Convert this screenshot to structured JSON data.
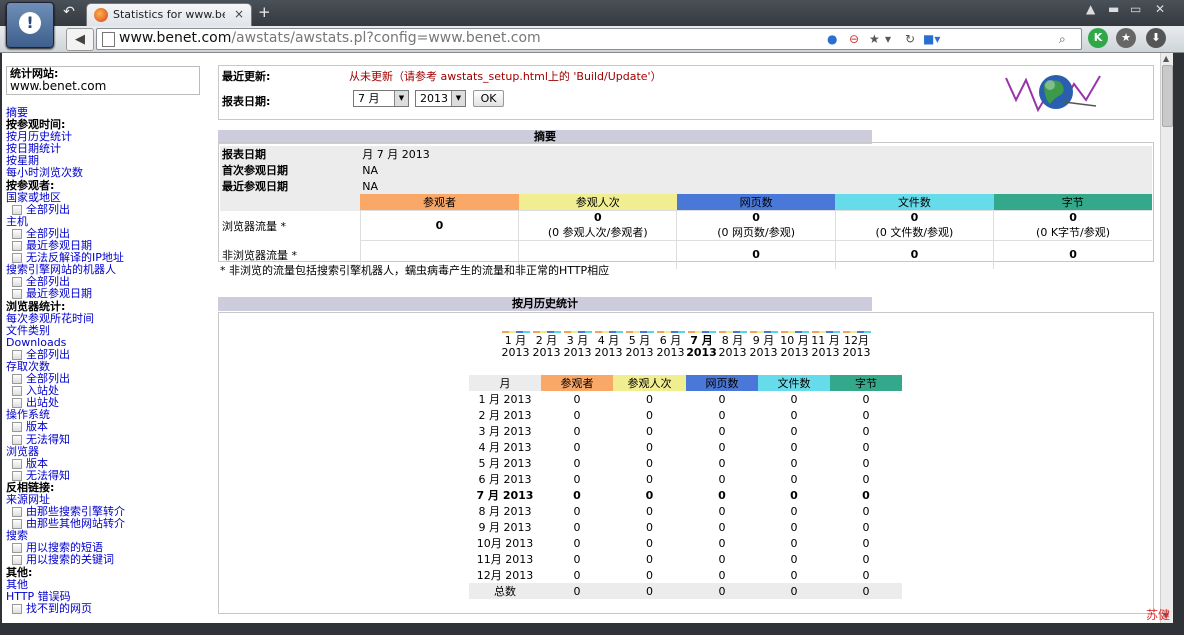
{
  "browser": {
    "tab_title": "Statistics for www.ben…",
    "tab_close": "×",
    "new_tab": "+",
    "url_domain": "www.benet.com",
    "url_path": "/awstats/awstats.pl?config=www.benet.com"
  },
  "sidebar": {
    "site_label": "统计网站:",
    "site_value": "www.benet.com",
    "items": [
      {
        "text": "摘要",
        "kind": "link"
      },
      {
        "text": "按参观时间:",
        "kind": "head"
      },
      {
        "text": "按月历史统计",
        "kind": "link"
      },
      {
        "text": "按日期统计",
        "kind": "link"
      },
      {
        "text": "按星期",
        "kind": "link"
      },
      {
        "text": "每小时浏览次数",
        "kind": "link"
      },
      {
        "text": "按参观者:",
        "kind": "head"
      },
      {
        "text": "国家或地区",
        "kind": "link"
      },
      {
        "text": "全部列出",
        "kind": "sub"
      },
      {
        "text": "主机",
        "kind": "link"
      },
      {
        "text": "全部列出",
        "kind": "sub"
      },
      {
        "text": "最近参观日期",
        "kind": "sub"
      },
      {
        "text": "无法反解译的IP地址",
        "kind": "sub"
      },
      {
        "text": "搜索引擎网站的机器人",
        "kind": "link"
      },
      {
        "text": "全部列出",
        "kind": "sub"
      },
      {
        "text": "最近参观日期",
        "kind": "sub"
      },
      {
        "text": "浏览器统计:",
        "kind": "head"
      },
      {
        "text": "每次参观所花时间",
        "kind": "link"
      },
      {
        "text": "文件类别",
        "kind": "link"
      },
      {
        "text": "Downloads",
        "kind": "link"
      },
      {
        "text": "全部列出",
        "kind": "sub"
      },
      {
        "text": "存取次数",
        "kind": "link"
      },
      {
        "text": "全部列出",
        "kind": "sub"
      },
      {
        "text": "入站处",
        "kind": "sub"
      },
      {
        "text": "出站处",
        "kind": "sub"
      },
      {
        "text": "操作系统",
        "kind": "link"
      },
      {
        "text": "版本",
        "kind": "sub"
      },
      {
        "text": "无法得知",
        "kind": "sub"
      },
      {
        "text": "浏览器",
        "kind": "link"
      },
      {
        "text": "版本",
        "kind": "sub"
      },
      {
        "text": "无法得知",
        "kind": "sub"
      },
      {
        "text": "反相链接:",
        "kind": "head"
      },
      {
        "text": "来源网址",
        "kind": "link"
      },
      {
        "text": "由那些搜索引擎转介",
        "kind": "sub"
      },
      {
        "text": "由那些其他网站转介",
        "kind": "sub"
      },
      {
        "text": "搜索",
        "kind": "link"
      },
      {
        "text": "用以搜索的短语",
        "kind": "sub"
      },
      {
        "text": "用以搜索的关键词",
        "kind": "sub"
      },
      {
        "text": "其他:",
        "kind": "head"
      },
      {
        "text": "其他",
        "kind": "link"
      },
      {
        "text": "HTTP 错误码",
        "kind": "link"
      },
      {
        "text": "找不到的网页",
        "kind": "sub"
      }
    ]
  },
  "top": {
    "last_update_label": "最近更新:",
    "last_update_value": "从未更新（请参考 awstats_setup.html上的 'Build/Update'）",
    "report_date_label": "报表日期:",
    "month_select": "7 月",
    "year_select": "2013",
    "ok_label": "OK"
  },
  "summary": {
    "title": "摘要",
    "report_date_label": "报表日期",
    "report_date_value": "月 7 月 2013",
    "first_visit_label": "首次参观日期",
    "first_visit_value": "NA",
    "last_visit_label": "最近参观日期",
    "last_visit_value": "NA",
    "columns": [
      "参观者",
      "参观人次",
      "网页数",
      "文件数",
      "字节"
    ],
    "column_colors": [
      "#f9a868",
      "#f0ee90",
      "#4a78d8",
      "#66dcea",
      "#33a88a"
    ],
    "viewed_label": "浏览器流量 *",
    "viewed_values": [
      "0",
      "0",
      "0",
      "0",
      "0"
    ],
    "viewed_subs": [
      "",
      "(0 参观人次/参观者)",
      "(0 网页数/参观)",
      "(0 文件数/参观)",
      "(0 K字节/参观)"
    ],
    "notviewed_label": "非浏览器流量 *",
    "notviewed_values": [
      "",
      "",
      "0",
      "0",
      "0"
    ],
    "footnote": "* 非浏览的流量包括搜索引擎机器人，蠕虫病毒产生的流量和非正常的HTTP相应"
  },
  "monthly": {
    "title": "按月历史统计",
    "month_labels": [
      "1 月",
      "2 月",
      "3 月",
      "4 月",
      "5 月",
      "6 月",
      "7 月",
      "8 月",
      "9 月",
      "10 月",
      "11 月",
      "12月"
    ],
    "year_label": "2013",
    "header": [
      "月",
      "参观者",
      "参观人次",
      "网页数",
      "文件数",
      "字节"
    ],
    "rows": [
      [
        "1 月 2013",
        "0",
        "0",
        "0",
        "0",
        "0"
      ],
      [
        "2 月 2013",
        "0",
        "0",
        "0",
        "0",
        "0"
      ],
      [
        "3 月 2013",
        "0",
        "0",
        "0",
        "0",
        "0"
      ],
      [
        "4 月 2013",
        "0",
        "0",
        "0",
        "0",
        "0"
      ],
      [
        "5 月 2013",
        "0",
        "0",
        "0",
        "0",
        "0"
      ],
      [
        "6 月 2013",
        "0",
        "0",
        "0",
        "0",
        "0"
      ],
      [
        "7 月 2013",
        "0",
        "0",
        "0",
        "0",
        "0"
      ],
      [
        "8 月 2013",
        "0",
        "0",
        "0",
        "0",
        "0"
      ],
      [
        "9 月 2013",
        "0",
        "0",
        "0",
        "0",
        "0"
      ],
      [
        "10月 2013",
        "0",
        "0",
        "0",
        "0",
        "0"
      ],
      [
        "11月 2013",
        "0",
        "0",
        "0",
        "0",
        "0"
      ],
      [
        "12月 2013",
        "0",
        "0",
        "0",
        "0",
        "0"
      ]
    ],
    "total": [
      "总数",
      "0",
      "0",
      "0",
      "0",
      "0"
    ]
  },
  "signature": "苏健"
}
